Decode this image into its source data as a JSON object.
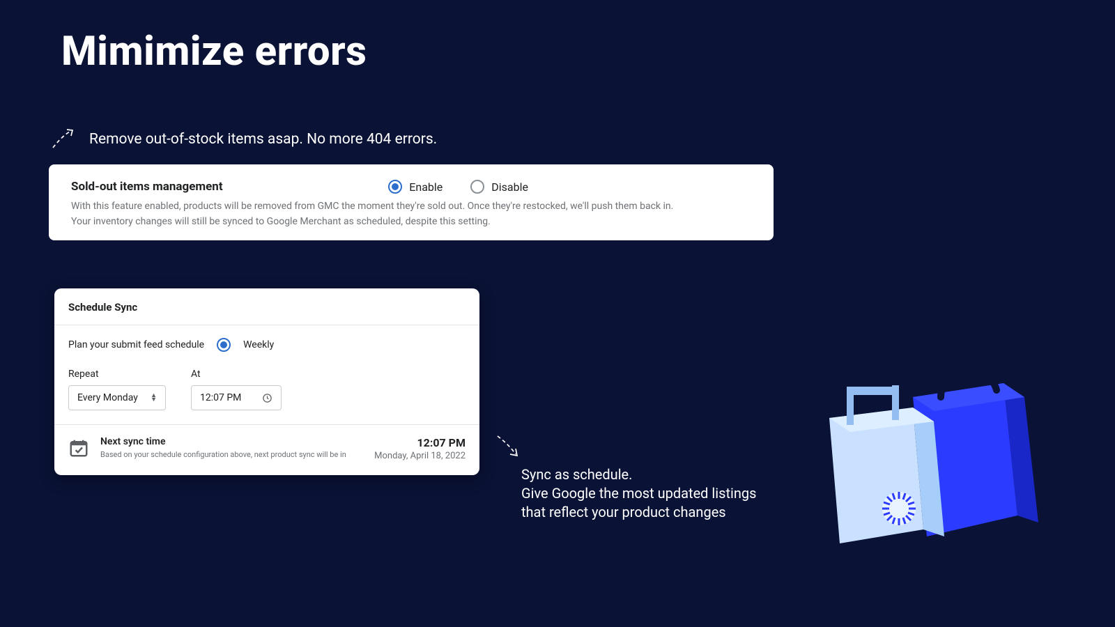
{
  "header": {
    "title": "Mimimize errors",
    "subtitle": "Remove out-of-stock items asap. No more 404 errors."
  },
  "soldout": {
    "title": "Sold-out items management",
    "enable_label": "Enable",
    "disable_label": "Disable",
    "selected": "enable",
    "desc_line1": "With this feature enabled, products will be removed from GMC the moment they're sold out. Once they're restocked, we'll push them back in.",
    "desc_line2": "Your inventory changes will still be synced to Google Merchant as scheduled, despite this setting."
  },
  "schedule": {
    "title": "Schedule Sync",
    "plan_label": "Plan your submit feed schedule",
    "frequency_label": "Weekly",
    "repeat_label": "Repeat",
    "repeat_value": "Every Monday",
    "at_label": "At",
    "at_value": "12:07 PM",
    "next_title": "Next sync time",
    "next_sub": "Based on your schedule configuration above, next product sync will be in",
    "next_time": "12:07 PM",
    "next_date": "Monday, April 18, 2022"
  },
  "blurb": {
    "line1": "Sync as schedule.",
    "line2": "Give Google the most updated listings that reflect your product changes"
  }
}
